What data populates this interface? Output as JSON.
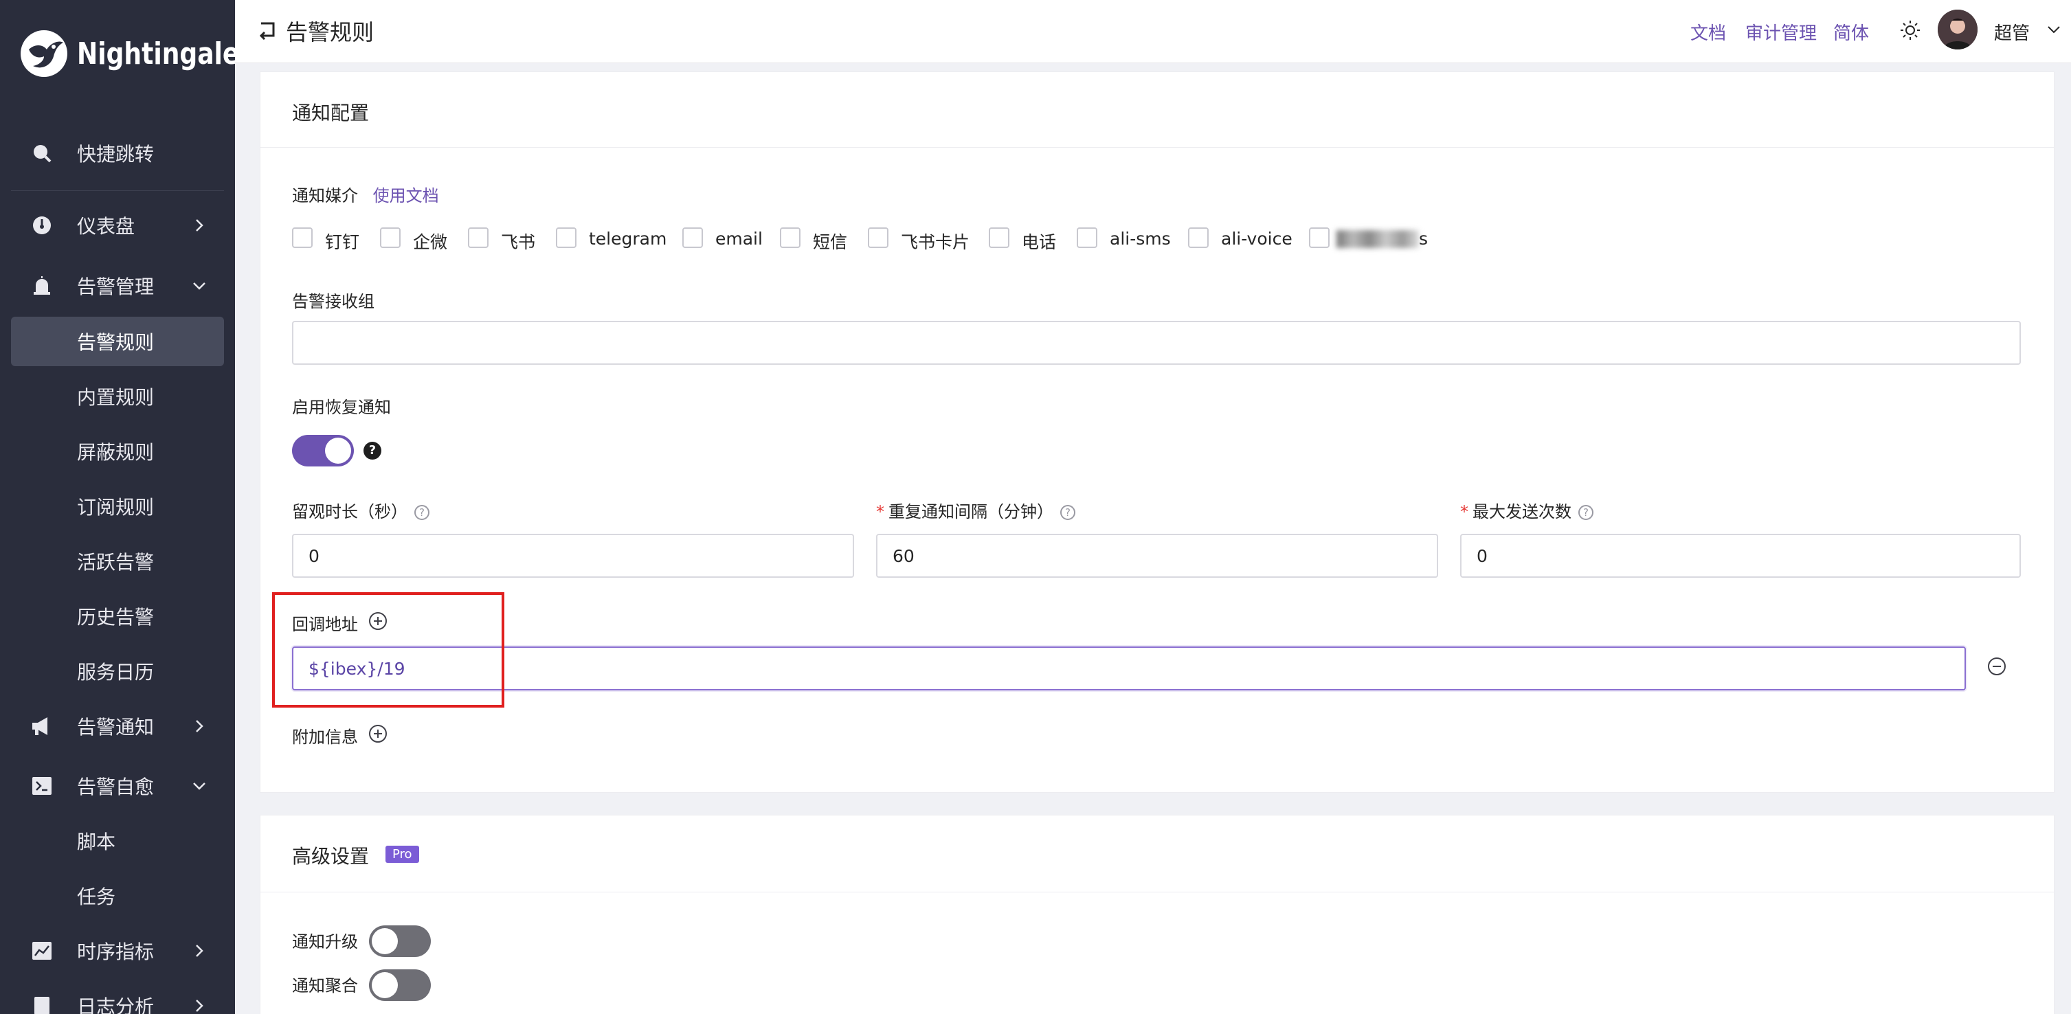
{
  "app": {
    "name": "Nightingale"
  },
  "sidebar": {
    "quick_jump": "快捷跳转",
    "dashboard": "仪表盘",
    "alert_mgmt": "告警管理",
    "alert_mgmt_items": [
      "告警规则",
      "内置规则",
      "屏蔽规则",
      "订阅规则",
      "活跃告警",
      "历史告警",
      "服务日历"
    ],
    "alert_notify": "告警通知",
    "self_heal": "告警自愈",
    "self_heal_items": [
      "脚本",
      "任务"
    ],
    "timeseries": "时序指标",
    "log_analysis": "日志分析"
  },
  "header": {
    "title": "告警规则",
    "docs": "文档",
    "audit": "审计管理",
    "lang": "简体",
    "user": "超管"
  },
  "notify": {
    "section_title": "通知配置",
    "media_label": "通知媒介",
    "media_doc_link": "使用文档",
    "channels": [
      "钉钉",
      "企微",
      "飞书",
      "telegram",
      "email",
      "短信",
      "飞书卡片",
      "电话",
      "ali-sms",
      "ali-voice",
      "s"
    ],
    "receiver_label": "告警接收组",
    "receiver_value": "",
    "recovery_label": "启用恢复通知",
    "recovery_enabled": true,
    "observe_label": "留观时长（秒）",
    "observe_value": "0",
    "repeat_label": "重复通知间隔（分钟）",
    "repeat_value": "60",
    "max_send_label": "最大发送次数",
    "max_send_value": "0",
    "callback_label": "回调地址",
    "callback_value": "${ibex}/19",
    "extra_label": "附加信息"
  },
  "advanced": {
    "section_title": "高级设置",
    "badge": "Pro",
    "escalation_label": "通知升级",
    "escalation_enabled": false,
    "aggregate_label": "通知聚合",
    "aggregate_enabled": false
  },
  "colors": {
    "sidebar_bg": "#2a2d3c",
    "accent": "#6c53b1",
    "highlight": "#e0201f"
  }
}
